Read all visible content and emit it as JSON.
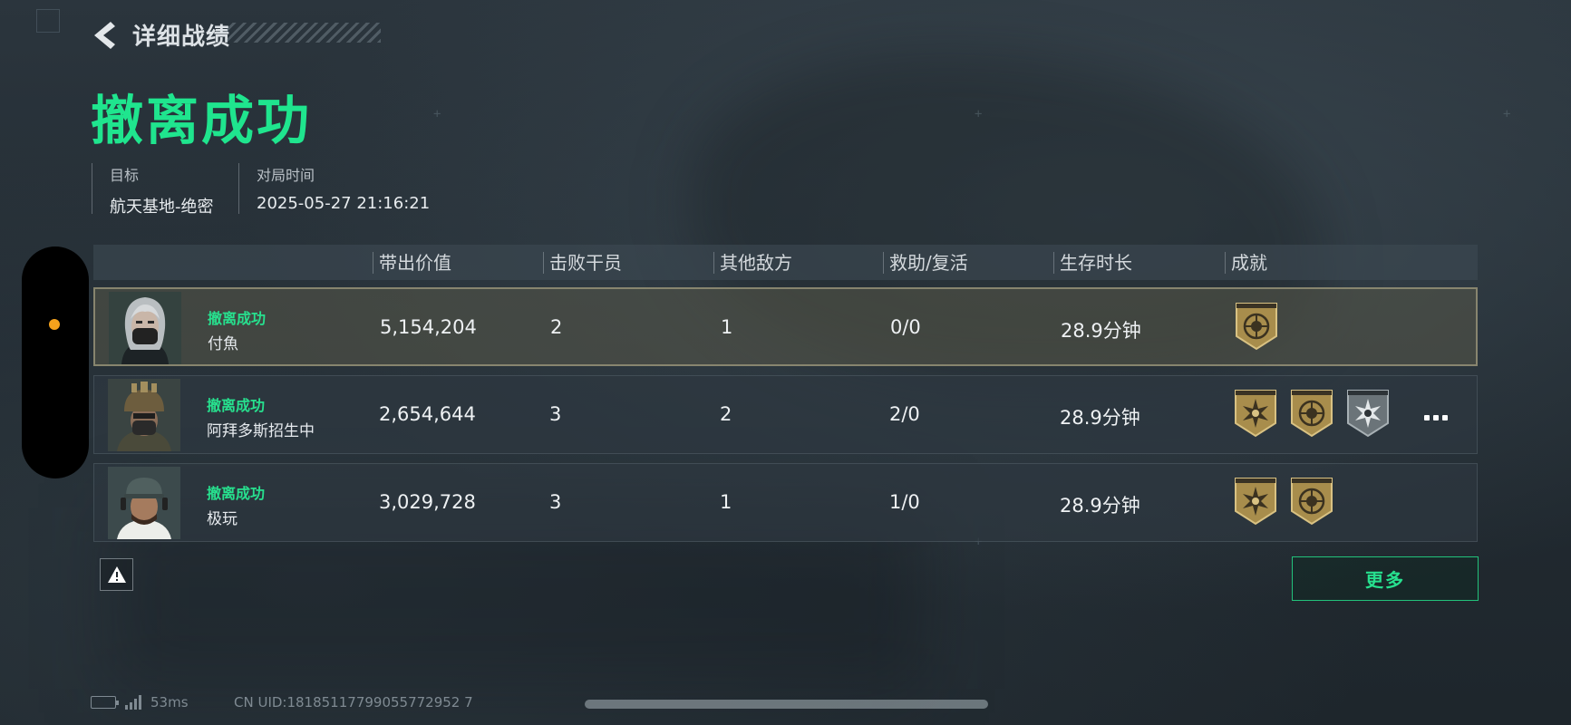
{
  "header": {
    "title": "详细战绩"
  },
  "result": {
    "title": "撤离成功"
  },
  "meta": {
    "target_label": "目标",
    "target_value": "航天基地-绝密",
    "time_label": "对局时间",
    "time_value": "2025-05-27 21:16:21"
  },
  "table": {
    "columns": [
      "带出价值",
      "击败干员",
      "其他敌方",
      "救助/复活",
      "生存时长",
      "成就"
    ],
    "rows": [
      {
        "status": "撤离成功",
        "name": "付魚",
        "value": "5,154,204",
        "kills": "2",
        "enemies": "1",
        "assist": "0/0",
        "time": "28.9分钟",
        "badges": [
          "gold-emblem-icon"
        ],
        "highlight": true
      },
      {
        "status": "撤离成功",
        "name": "阿拜多斯招生中",
        "value": "2,654,644",
        "kills": "3",
        "enemies": "2",
        "assist": "2/0",
        "time": "28.9分钟",
        "badges": [
          "gold-star-burst-icon",
          "gold-emblem-icon",
          "silver-star-burst-icon"
        ],
        "more": true
      },
      {
        "status": "撤离成功",
        "name": "极玩",
        "value": "3,029,728",
        "kills": "3",
        "enemies": "1",
        "assist": "1/0",
        "time": "28.9分钟",
        "badges": [
          "gold-star-burst-icon",
          "gold-emblem-icon"
        ]
      }
    ]
  },
  "buttons": {
    "more_label": "更多",
    "warning_icon": "warning-icon"
  },
  "status_bar": {
    "ping": "53ms",
    "uid": "CN UID:18185117799055772952 7"
  },
  "colors": {
    "accent_green": "#27e08e",
    "highlight_row": "#58584a",
    "badge_gold": "#b59a55"
  }
}
